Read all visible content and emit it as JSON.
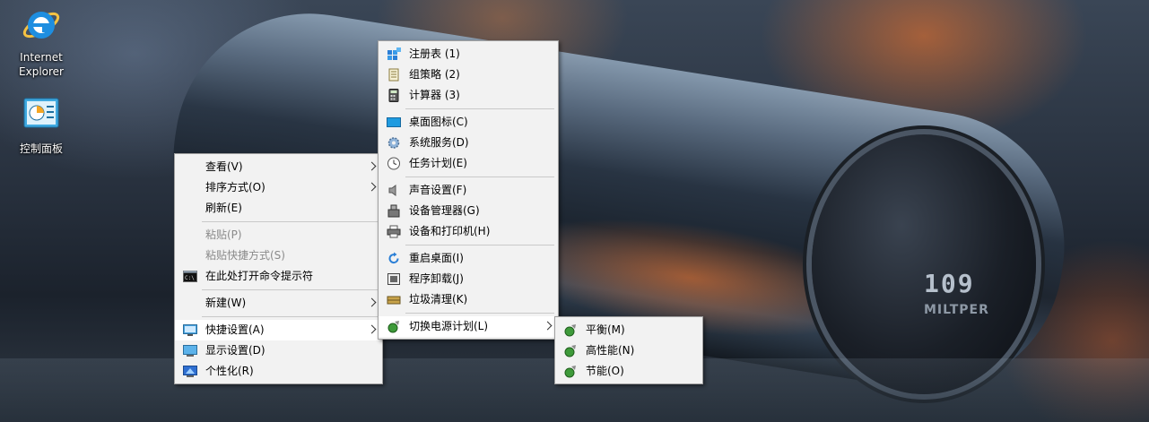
{
  "desktop_icons": [
    {
      "label_line1": "Internet",
      "label_line2": "Explorer",
      "icon": "internet-explorer-icon"
    },
    {
      "label_line1": "控制面板",
      "label_line2": "",
      "icon": "control-panel-icon"
    }
  ],
  "wallpaper": {
    "cap_text": "109",
    "cap_subtext": "MILTPER"
  },
  "context_menu": {
    "items": [
      {
        "label": "查看(V)",
        "submenu": true
      },
      {
        "label": "排序方式(O)",
        "submenu": true
      },
      {
        "label": "刷新(E)"
      },
      {
        "label": "粘贴(P)",
        "disabled": true
      },
      {
        "label": "粘贴快捷方式(S)",
        "disabled": true
      },
      {
        "label": "在此处打开命令提示符",
        "icon": "cmd-icon"
      },
      {
        "label": "新建(W)",
        "submenu": true
      },
      {
        "label": "快捷设置(A)",
        "submenu": true,
        "icon": "quick-settings-icon",
        "highlighted": true
      },
      {
        "label": "显示设置(D)",
        "icon": "display-settings-icon"
      },
      {
        "label": "个性化(R)",
        "icon": "personalize-icon"
      }
    ]
  },
  "quick_settings_menu": {
    "items": [
      {
        "label": "注册表  (1)",
        "icon": "registry-icon"
      },
      {
        "label": "组策略  (2)",
        "icon": "group-policy-icon"
      },
      {
        "label": "计算器  (3)",
        "icon": "calculator-icon"
      },
      {
        "label": "桌面图标(C)",
        "icon": "desktop-icons-icon"
      },
      {
        "label": "系统服务(D)",
        "icon": "services-gear-icon"
      },
      {
        "label": "任务计划(E)",
        "icon": "task-scheduler-clock-icon"
      },
      {
        "label": "声音设置(F)",
        "icon": "speaker-icon"
      },
      {
        "label": "设备管理器(G)",
        "icon": "device-manager-icon"
      },
      {
        "label": "设备和打印机(H)",
        "icon": "printer-icon"
      },
      {
        "label": "重启桌面(I)",
        "icon": "restart-icon"
      },
      {
        "label": "程序卸载(J)",
        "icon": "uninstall-icon"
      },
      {
        "label": "垃圾清理(K)",
        "icon": "cleanup-icon"
      },
      {
        "label": "切换电源计划(L)",
        "icon": "power-plan-icon",
        "submenu": true,
        "highlighted": true
      }
    ]
  },
  "power_plan_menu": {
    "items": [
      {
        "label": "平衡(M)",
        "icon": "power-plan-icon"
      },
      {
        "label": "高性能(N)",
        "icon": "power-plan-icon"
      },
      {
        "label": "节能(O)",
        "icon": "power-plan-icon"
      }
    ]
  }
}
